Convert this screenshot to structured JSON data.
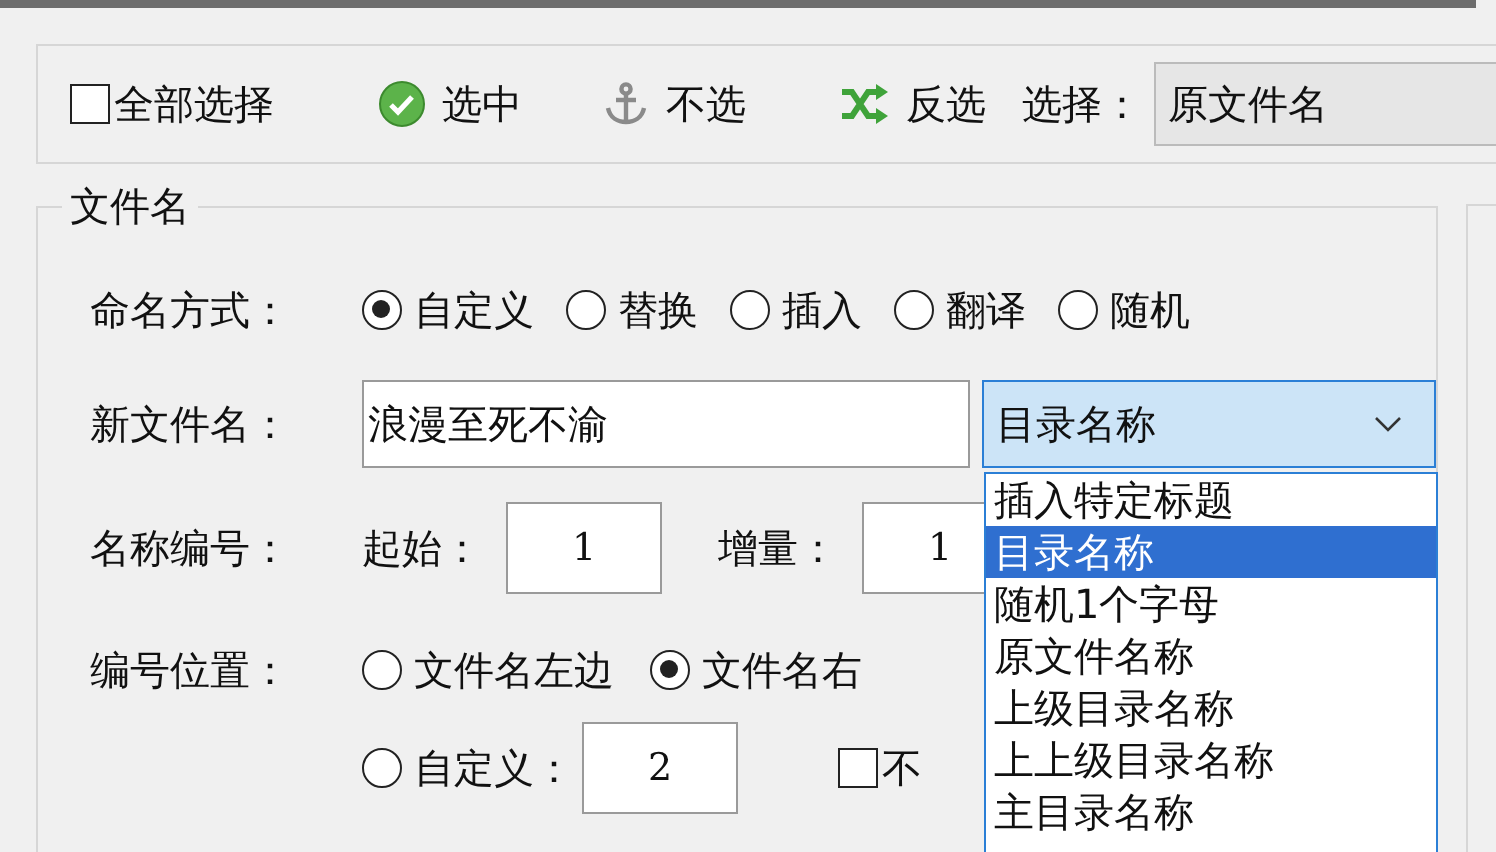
{
  "toolbar": {
    "select_all": {
      "label": "全部选择",
      "checked": false
    },
    "buttons": [
      {
        "kind": "check",
        "label": "选中"
      },
      {
        "kind": "anchor",
        "label": "不选"
      },
      {
        "kind": "shuffle",
        "label": "反选"
      }
    ],
    "select_label": "选择：",
    "select_value": "原文件名"
  },
  "group": {
    "title": "文件名",
    "naming_mode": {
      "label": "命名方式：",
      "options": [
        {
          "label": "自定义",
          "selected": true
        },
        {
          "label": "替换",
          "selected": false
        },
        {
          "label": "插入",
          "selected": false
        },
        {
          "label": "翻译",
          "selected": false
        },
        {
          "label": "随机",
          "selected": false
        }
      ]
    },
    "new_name": {
      "label": "新文件名：",
      "value": "浪漫至死不渝",
      "combo_value": "目录名称",
      "dropdown": [
        {
          "label": "插入特定标题",
          "selected": false
        },
        {
          "label": "目录名称",
          "selected": true
        },
        {
          "label": "随机1个字母",
          "selected": false
        },
        {
          "label": "原文件名称",
          "selected": false
        },
        {
          "label": "上级目录名称",
          "selected": false
        },
        {
          "label": "上上级目录名称",
          "selected": false
        },
        {
          "label": "主目录名称",
          "selected": false
        }
      ]
    },
    "numbering": {
      "label": "名称编号：",
      "start_label": "起始：",
      "start": "1",
      "step_label": "增量：",
      "step": "1"
    },
    "position": {
      "label": "编号位置：",
      "options": [
        {
          "label": "文件名左边",
          "selected": false
        },
        {
          "label": "文件名右",
          "selected": true
        },
        {
          "label": "自定义：",
          "selected": false
        }
      ],
      "custom_value": "2",
      "checkbox": {
        "label": "不",
        "checked": false
      }
    }
  }
}
